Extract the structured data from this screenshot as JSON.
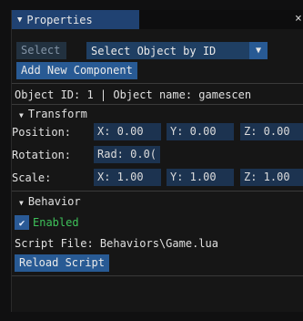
{
  "window": {
    "title": "Properties",
    "collapse_icon": "triangle-down-icon",
    "close_icon": "close-icon",
    "close_glyph": "×",
    "tab_color": "#204272"
  },
  "toolbar": {
    "select_label": "Select",
    "select_mode_value": "Select Object by ID",
    "dropdown_arrow": "▼",
    "add_component_label": "Add New Component"
  },
  "object_info": {
    "text": "Object ID: 1 | Object name: gamescen"
  },
  "transform": {
    "header": "Transform",
    "position": {
      "label": "Position:",
      "x": "X: 0.00",
      "y": "Y: 0.00",
      "z": "Z: 0.00"
    },
    "rotation": {
      "label": "Rotation:",
      "rad": "Rad: 0.0("
    },
    "scale": {
      "label": "Scale:",
      "x": "X: 1.00",
      "y": "Y: 1.00",
      "z": "Z: 1.00"
    }
  },
  "behavior": {
    "header": "Behavior",
    "enabled_label": "Enabled",
    "enabled_checked": true,
    "check_glyph": "✔",
    "script_file_text": "Script File: Behaviors\\Game.lua",
    "reload_label": "Reload Script"
  },
  "colors": {
    "button": "#285a94",
    "field": "#1c3350",
    "enabled_text": "#3ec25a",
    "background": "#161616"
  }
}
